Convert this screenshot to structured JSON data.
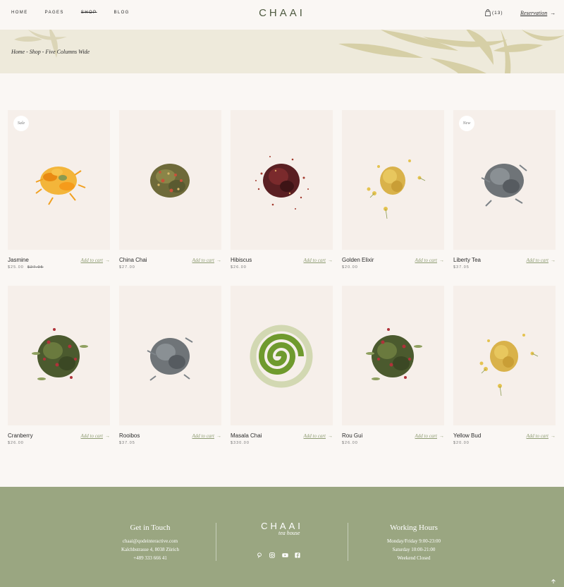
{
  "header": {
    "nav": [
      "Home",
      "Pages",
      "Shop",
      "Blog"
    ],
    "active_nav": "Shop",
    "logo": "CHAAI",
    "cart_count": "(13)",
    "reservation": "Reservation",
    "reservation_arrow": "→"
  },
  "banner": {
    "breadcrumb": "Home - Shop - Five Columns Wide"
  },
  "products": [
    {
      "name": "Jasmine",
      "price": "$25.00",
      "old_price": "$27.05",
      "badge": "Sale",
      "add_label": "Add to cart",
      "arrow": "→"
    },
    {
      "name": "China Chai",
      "price": "$27.00",
      "old_price": "",
      "badge": "",
      "add_label": "Add to cart",
      "arrow": "→"
    },
    {
      "name": "Hibiscus",
      "price": "$26.00",
      "old_price": "",
      "badge": "",
      "add_label": "Add to cart",
      "arrow": "→"
    },
    {
      "name": "Golden Elixir",
      "price": "$20.00",
      "old_price": "",
      "badge": "",
      "add_label": "Add to cart",
      "arrow": "→"
    },
    {
      "name": "Liberty Tea",
      "price": "$37.05",
      "old_price": "",
      "badge": "New",
      "add_label": "Add to cart",
      "arrow": "→"
    },
    {
      "name": "Cranberry",
      "price": "$26.00",
      "old_price": "",
      "badge": "",
      "add_label": "Add to cart",
      "arrow": "→"
    },
    {
      "name": "Rooibos",
      "price": "$37.05",
      "old_price": "",
      "badge": "",
      "add_label": "Add to cart",
      "arrow": "→"
    },
    {
      "name": "Masala Chai",
      "price": "$330.00",
      "old_price": "",
      "badge": "",
      "add_label": "Add to cart",
      "arrow": "→"
    },
    {
      "name": "Rou Gui",
      "price": "$26.00",
      "old_price": "",
      "badge": "",
      "add_label": "Add to cart",
      "arrow": "→"
    },
    {
      "name": "Yellow Bud",
      "price": "$20.00",
      "old_price": "",
      "badge": "",
      "add_label": "Add to cart",
      "arrow": "→"
    }
  ],
  "footer": {
    "contact_title": "Get in Touch",
    "email": "chaai@qodeinteractive.com",
    "address": "Kalchbstrasse 4, 8038 Zürich",
    "phone": "+489 333 666 41",
    "logo": "CHAAI",
    "logo_script": "tea house",
    "hours_title": "Working Hours",
    "hours_weekday": "Monday/Friday 9:00-23:00",
    "hours_saturday": "Saturday 10:00-21:00",
    "hours_weekend": "Weekend Closed",
    "social": [
      "pinterest-icon",
      "instagram-icon",
      "youtube-icon",
      "facebook-icon"
    ]
  },
  "colors": {
    "accent": "#8e9c72",
    "footer_bg": "#9aa681",
    "banner_bg": "#eeeadb",
    "card_bg": "#f6efea"
  }
}
